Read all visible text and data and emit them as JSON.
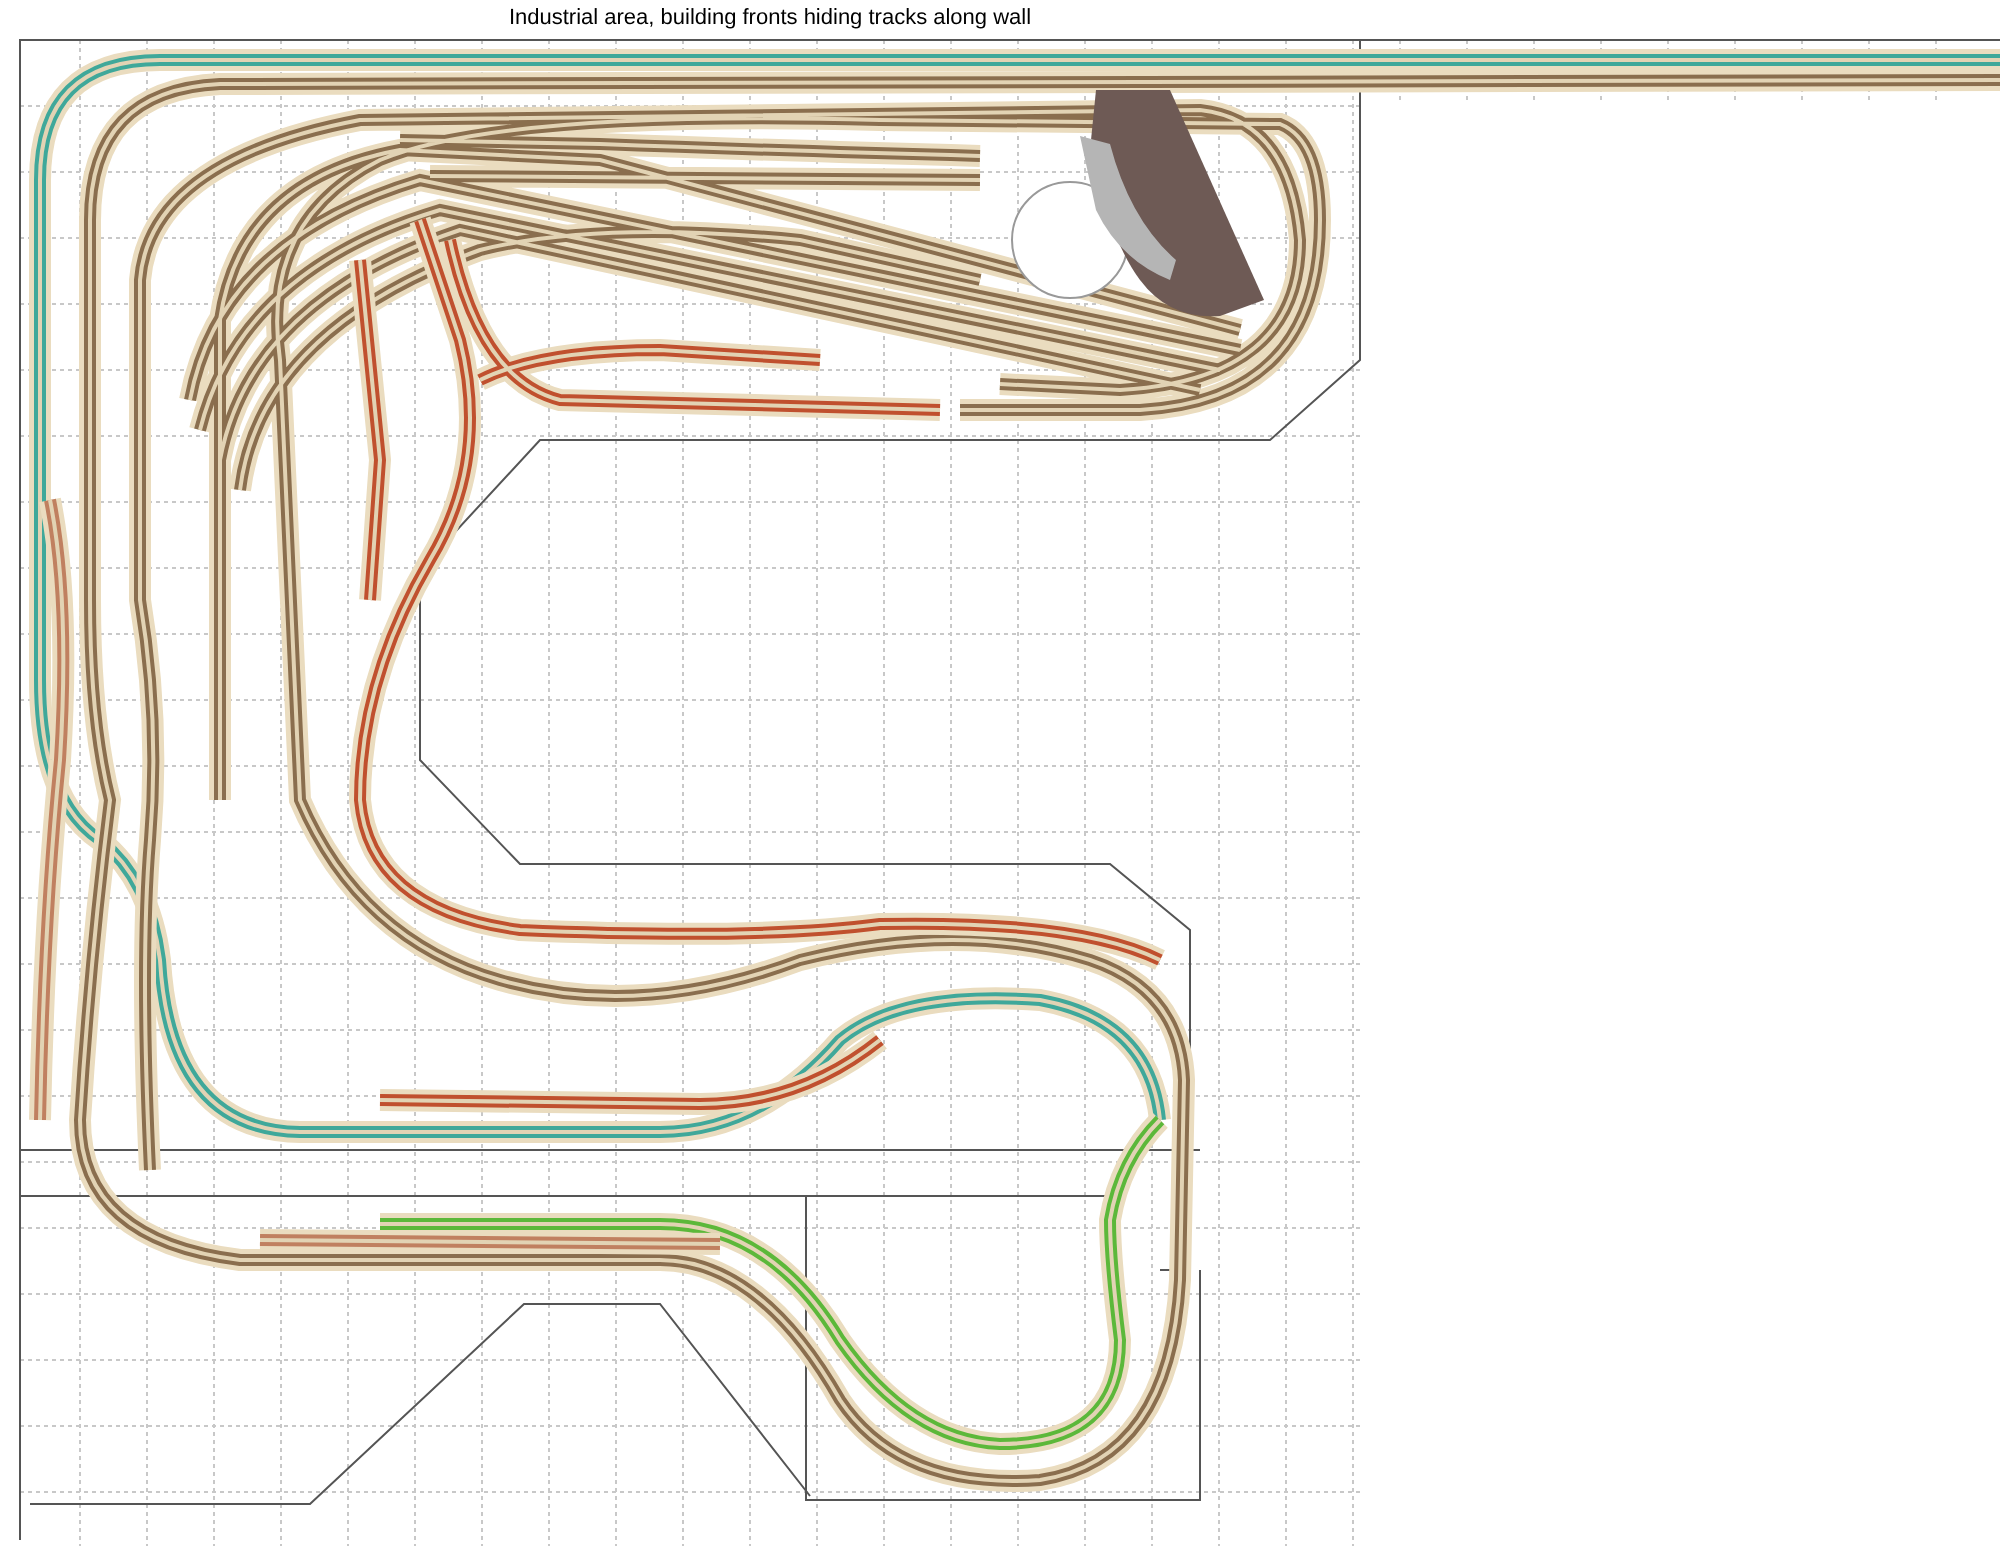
{
  "canvas": {
    "title": "Industrial area, building fronts hiding tracks along wall"
  },
  "tracks": [
    {
      "color": "#3fa89a"
    },
    {
      "color": "#5cb83a"
    },
    {
      "color": "#8a6e4e"
    },
    {
      "color": "#c0502e"
    },
    {
      "color": "#c08060"
    },
    {
      "color": "#c08060"
    }
  ]
}
